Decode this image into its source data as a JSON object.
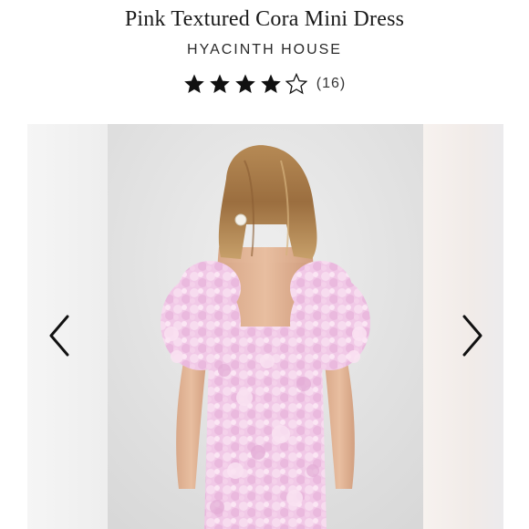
{
  "product": {
    "title": "Pink Textured Cora Mini Dress",
    "brand": "HYACINTH HOUSE",
    "rating": 4,
    "rating_max": 5,
    "review_count_label": "(16)"
  },
  "icons": {
    "star_filled": "star-filled-icon",
    "star_empty": "star-outline-icon",
    "prev": "chevron-left-icon",
    "next": "chevron-right-icon"
  },
  "colors": {
    "text": "#1a1a1a",
    "star": "#111111",
    "dress": "#f0c8e6",
    "background": "#e2e2e2"
  }
}
